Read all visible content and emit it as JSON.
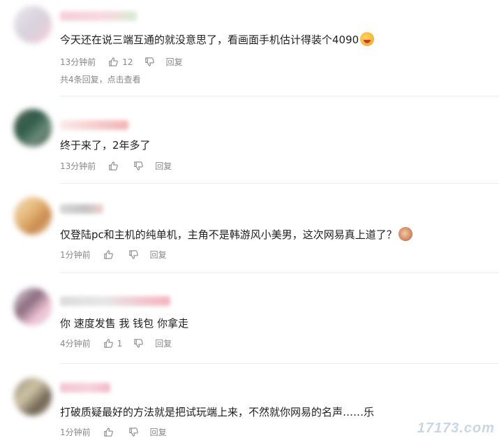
{
  "comments": [
    {
      "text": "今天还在说三端互通的就没意思了，看画面手机估计得装个4090",
      "time": "13分钟前",
      "likes": "12",
      "reply_label": "回复",
      "replies_summary": "共4条回复，点击查看",
      "emoji": "face-emoji"
    },
    {
      "text": "终于来了，2年多了",
      "time": "13分钟前",
      "likes": "",
      "reply_label": "回复"
    },
    {
      "text": "仅登陆pc和主机的纯单机，主角不是韩游风小美男，这次网易真上道了？",
      "time": "1分钟前",
      "likes": "",
      "reply_label": "回复",
      "emoji": "face-emoji"
    },
    {
      "text": "你 速度发售 我 钱包 你拿走",
      "time": "4分钟前",
      "likes": "1",
      "reply_label": "回复"
    },
    {
      "text": "打破质疑最好的方法就是把试玩端上来，不然就你网易的名声……乐",
      "time": "1分钟前",
      "likes": "",
      "reply_label": "回复"
    }
  ],
  "icons": {
    "like": "thumb-up-icon",
    "dislike": "thumb-down-icon"
  },
  "watermark": "17173.com"
}
